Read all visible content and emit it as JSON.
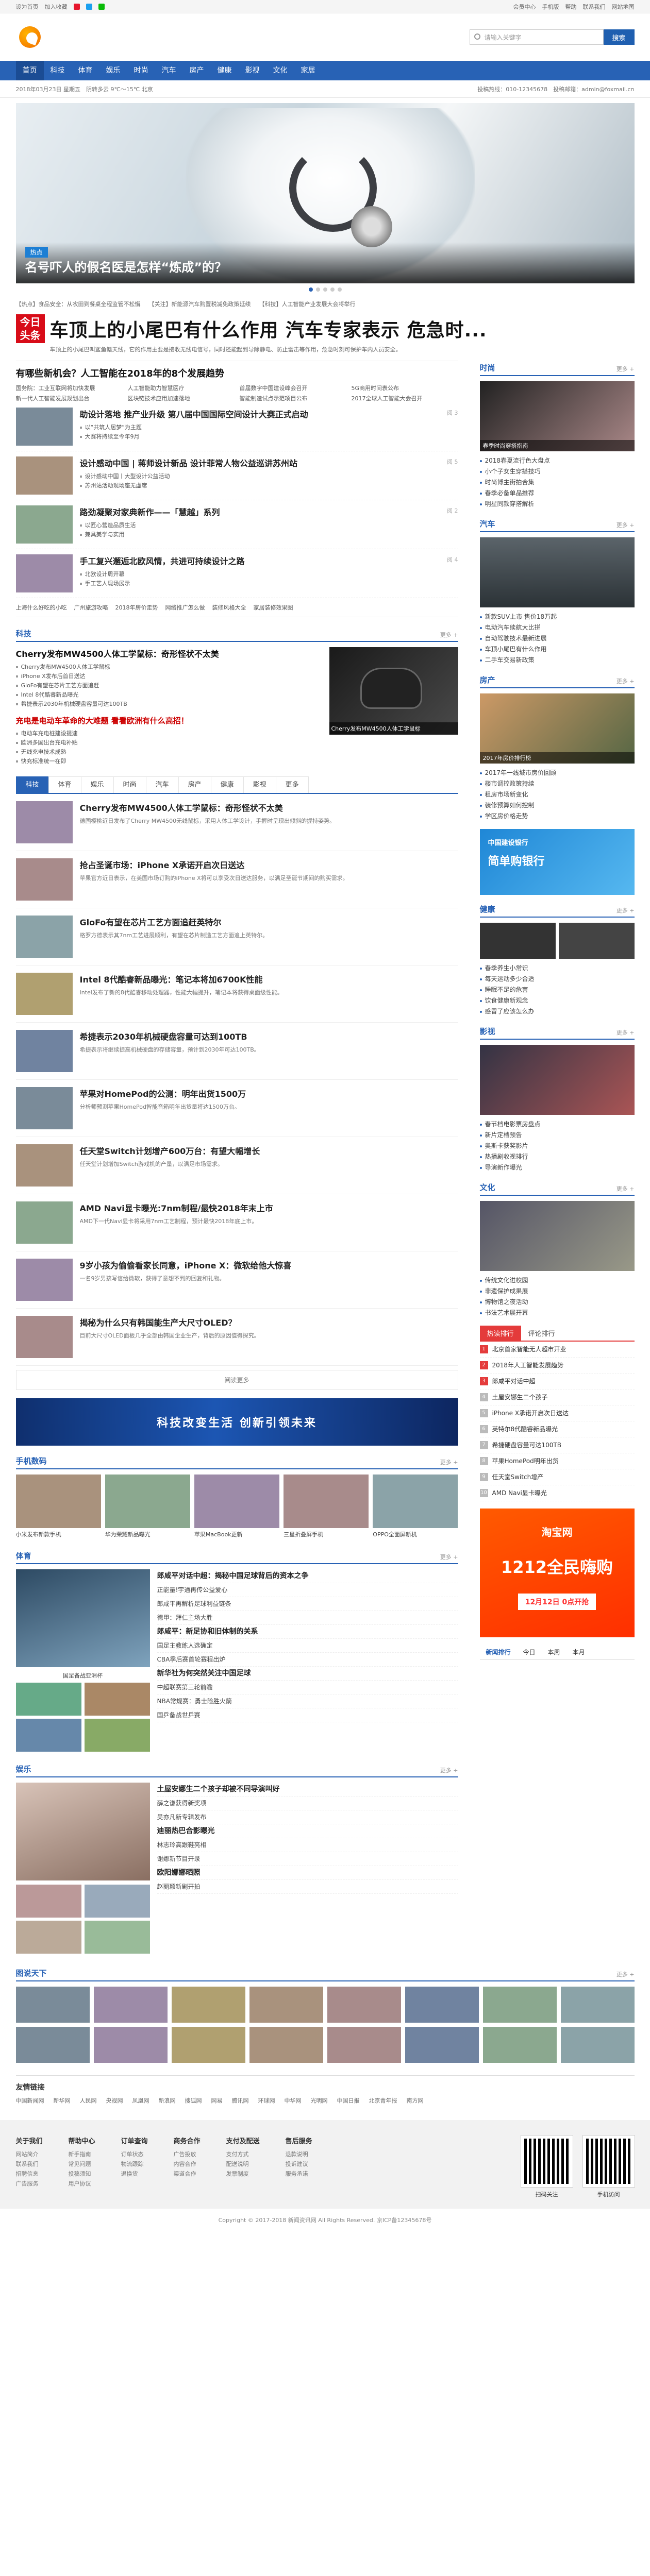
{
  "topbar": {
    "left": [
      "设为首页",
      "加入收藏",
      "新浪微博",
      "腾讯微博",
      "微信"
    ],
    "right": [
      "会员中心",
      "手机版",
      "帮助",
      "联系我们",
      "网站地图"
    ]
  },
  "search": {
    "placeholder": "请输入关键字",
    "button": "搜索"
  },
  "nav": [
    "首页",
    "科技",
    "体育",
    "娱乐",
    "时尚",
    "汽车",
    "房产",
    "健康",
    "影视",
    "文化",
    "家居"
  ],
  "subbar": {
    "date": "2018年03月23日 星期五",
    "weather": "阴转多云 9℃～15℃ 北京",
    "hotline": "投稿热线：010-12345678",
    "email": "投稿邮箱：admin@foxmail.cn"
  },
  "hero": {
    "tag": "热点",
    "title": "名号吓人的假名医是怎样“炼成”的？"
  },
  "strip": [
    "【热点】食品安全：从农田到餐桌全程监管不松懈",
    "【关注】新能源汽车购置税减免政策延续",
    "【科技】人工智能产业发展大会将举行"
  ],
  "headline": {
    "badge": "今日头条",
    "title": "车顶上的小尾巴有什么作用 汽车专家表示 危急时...",
    "sub": "车顶上的小尾巴叫鲨鱼鳍天线，它的作用主要是接收无线电信号，同时还能起到导除静电、防止雷击等作用，危急时刻可保护车内人员安全。"
  },
  "lead": {
    "title": "有哪些新机会？人工智能在2018年的8个发展趋势",
    "links": [
      "国务院：工业互联网将加快发展",
      "人工智能助力智慧医疗",
      "首届数字中国建设峰会召开",
      "5G商用时间表公布",
      "新一代人工智能发展规划出台",
      "区块链技术应用加速落地",
      "智能制造试点示范项目公布",
      "2017全球人工智能大会召开"
    ]
  },
  "list": [
    {
      "title": "助设计落地 推产业升级 第八届中国国际空间设计大赛正式启动",
      "b": [
        "以“共筑人居梦”为主题",
        "大赛将持续至今年9月"
      ],
      "m": "阅 3"
    },
    {
      "title": "设计感动中国 | 蒋师设计新品 设计菲常人物公益巡讲苏州站",
      "b": [
        "设计感动中国丨大型设计公益活动",
        "苏州站活动现场座无虚席"
      ],
      "m": "阅 5"
    },
    {
      "title": "路劲凝聚对家典新作——「慧越」系列",
      "b": [
        "以匠心营造品质生活",
        "兼具美学与实用"
      ],
      "m": "阅 2"
    },
    {
      "title": "手工复兴邂逅北欧风情，共进可持续设计之路",
      "b": [
        "北欧设计周开幕",
        "手工艺人现场展示"
      ],
      "m": "阅 4"
    }
  ],
  "linkrow": [
    "上海什么好吃的小吃",
    "广州旅游攻略",
    "2018年房价走势",
    "网络推广怎么做",
    "装修风格大全",
    "家居装修效果图"
  ],
  "tech": {
    "label": "科技",
    "more": "更多 +",
    "feat": "Cherry发布MW4500人体工学鼠标：奇形怪状不太美",
    "featsum": "Cherry发布MW4500人体工学鼠标，采用人体工学设计，握持舒适，但外观较为奇特。",
    "bullets": [
      "Cherry发布MW4500人体工学鼠标",
      "iPhone X发布后首日送达",
      "GloFo有望在芯片工艺方面追赶",
      "Intel 8代酷睿新品曝光",
      "希捷表示2030年机械硬盘容量可达100TB"
    ],
    "feat2": "充电是电动车革命的大难题 看看欧洲有什么高招！",
    "bullets2": [
      "电动车充电桩建设提速",
      "欧洲多国出台充电补贴",
      "无线充电技术成熟",
      "快充标准统一在即"
    ],
    "imgcap": "Cherry发布MW4500人体工学鼠标"
  },
  "tabs": [
    "科技",
    "体育",
    "娱乐",
    "时尚",
    "汽车",
    "房产",
    "健康",
    "影视",
    "更多"
  ],
  "feed": [
    {
      "t": "Cherry发布MW4500人体工学鼠标：奇形怪状不太美",
      "s": "德国樱桃近日发布了Cherry MW4500无线鼠标，采用人体工学设计，手握时呈现出倾斜的握持姿势。"
    },
    {
      "t": "抢占圣诞市场：iPhone X承诺开启次日送达",
      "s": "苹果官方近日表示，在美国市场订购的iPhone X将可以享受次日送达服务，以满足圣诞节期间的购买需求。"
    },
    {
      "t": "GloFo有望在芯片工艺方面追赶英特尔",
      "s": "格罗方德表示其7nm工艺进展顺利，有望在芯片制造工艺方面追上英特尔。"
    },
    {
      "t": "Intel 8代酷睿新品曝光：笔记本将加6700K性能",
      "s": "Intel发布了新的8代酷睿移动处理器，性能大幅提升，笔记本将获得桌面级性能。"
    },
    {
      "t": "希捷表示2030年机械硬盘容量可达到100TB",
      "s": "希捷表示将继续提高机械硬盘的存储容量，预计到2030年可达100TB。"
    },
    {
      "t": "苹果对HomePod的公测：明年出货1500万",
      "s": "分析师预测苹果HomePod智能音箱明年出货量将达1500万台。"
    },
    {
      "t": "任天堂Switch计划增产600万台：有望大幅增长",
      "s": "任天堂计划增加Switch游戏机的产量，以满足市场需求。"
    },
    {
      "t": "AMD Navi显卡曝光:7nm制程/最快2018年末上市",
      "s": "AMD下一代Navi显卡将采用7nm工艺制程，预计最快2018年底上市。"
    },
    {
      "t": "9岁小孩为偷偷看家长同意，iPhone X：微软给他大惊喜",
      "s": "一名9岁男孩写信给微软，获得了意想不到的回复和礼物。"
    },
    {
      "t": "揭秘为什么只有韩国能生产大尺寸OLED？",
      "s": "目前大尺寸OLED面板几乎全部由韩国企业生产，背后的原因值得探究。"
    }
  ],
  "feedmore": "阅读更多",
  "banner": "科技改变生活 创新引领未来",
  "digital": {
    "label": "手机数码",
    "more": "更多 +",
    "items": [
      "小米发布新款手机",
      "华为荣耀新品曝光",
      "苹果MacBook更新",
      "三星折叠屏手机",
      "OPPO全面屏新机"
    ]
  },
  "sports": {
    "label": "体育",
    "more": "更多 +",
    "cap": "国足备战亚洲杯",
    "items": [
      {
        "b": "郎咸平对话中超：揭秘中国足球背后的资本之争"
      },
      {
        "t": "正能量!宇通再传公益爱心"
      },
      {
        "t": "郎咸平再解析足球利益链条"
      },
      {
        "t": "德甲：拜仁主场大胜"
      },
      {
        "b": "郎咸平：新足协和旧体制的关系"
      },
      {
        "t": "国足主教练人选确定"
      },
      {
        "t": "CBA季后赛首轮赛程出炉"
      },
      {
        "b": "新华社为何突然关注中国足球"
      },
      {
        "t": "中超联赛第三轮前瞻"
      },
      {
        "t": "NBA常规赛：勇士险胜火箭"
      },
      {
        "t": "国乒备战世乒赛"
      }
    ]
  },
  "ent": {
    "label": "娱乐",
    "more": "更多 +",
    "items": [
      "土屋安娜生二个孩子却被不同导演叫好",
      "薛之谦获得新奖项",
      "吴亦凡新专辑发布",
      "迪丽热巴合影曝光",
      "林志玲高跟鞋亮相",
      "谢娜新节目开录",
      "欧阳娜娜晒照",
      "赵丽颖新剧开拍"
    ]
  },
  "r": {
    "fashion": {
      "label": "时尚",
      "more": "更多 +",
      "cap": "春季时尚穿搭指南",
      "list": [
        "2018春夏流行色大盘点",
        "小个子女生穿搭技巧",
        "时尚博主街拍合集",
        "春季必备单品推荐",
        "明星同款穿搭解析"
      ]
    },
    "auto": {
      "label": "汽车",
      "more": "更多 +",
      "list": [
        "新款SUV上市 售价18万起",
        "电动汽车续航大比拼",
        "自动驾驶技术最新进展",
        "车顶小尾巴有什么作用",
        "二手车交易新政策"
      ]
    },
    "house": {
      "label": "房产",
      "more": "更多 +",
      "cap": "2017年房价排行榜",
      "list": [
        "2017年一线城市房价回顾",
        "楼市调控政策持续",
        "租房市场新变化",
        "装修预算如何控制",
        "学区房价格走势"
      ]
    },
    "health": {
      "label": "健康",
      "more": "更多 +",
      "list": [
        "春季养生小常识",
        "每天运动多少合适",
        "睡眠不足的危害",
        "饮食健康新观念",
        "感冒了应该怎么办"
      ]
    },
    "film": {
      "label": "影视",
      "more": "更多 +",
      "list": [
        "春节档电影票房盘点",
        "新片定档预告",
        "奥斯卡获奖影片",
        "热播剧收视排行",
        "导演新作曝光"
      ]
    },
    "culture": {
      "label": "文化",
      "more": "更多 +",
      "list": [
        "传统文化进校园",
        "非遗保护成果展",
        "博物馆之夜活动",
        "书法艺术展开幕"
      ]
    },
    "ranktabs": [
      "热读排行",
      "评论排行"
    ],
    "rank": [
      "北京首家智能无人超市开业",
      "2018年人工智能发展趋势",
      "郎咸平对话中超",
      "土屋安娜生二个孩子",
      "iPhone X承诺开启次日送达",
      "英特尔8代酷睿新品曝光",
      "希捷硬盘容量可达100TB",
      "苹果HomePod明年出货",
      "任天堂Switch增产",
      "AMD Navi显卡曝光"
    ],
    "newrank": [
      "新闻排行",
      "今日",
      "本周",
      "本月"
    ],
    "taobao": {
      "a": "淘宝网",
      "b": "1212全民嗨购",
      "c": "12月12日 0点开抢"
    },
    "gov": {
      "a": "中国建设银行",
      "b": "简单购银行"
    }
  },
  "pics": {
    "label": "图说天下",
    "more": "更多 +"
  },
  "friend": {
    "label": "友情链接",
    "links": [
      "中国新闻网",
      "新华网",
      "人民网",
      "央视网",
      "凤凰网",
      "新浪网",
      "搜狐网",
      "网易",
      "腾讯网",
      "环球网",
      "中华网",
      "光明网",
      "中国日报",
      "北京青年报",
      "南方网"
    ]
  },
  "footer": {
    "cols": [
      {
        "h": "关于我们",
        "l": [
          "网站简介",
          "联系我们",
          "招聘信息",
          "广告服务"
        ]
      },
      {
        "h": "帮助中心",
        "l": [
          "新手指南",
          "常见问题",
          "投稿须知",
          "用户协议"
        ]
      },
      {
        "h": "订单查询",
        "l": [
          "订单状态",
          "物流跟踪",
          "退换货"
        ]
      },
      {
        "h": "商务合作",
        "l": [
          "广告投放",
          "内容合作",
          "渠道合作"
        ]
      },
      {
        "h": "支付及配送",
        "l": [
          "支付方式",
          "配送说明",
          "发票制度"
        ]
      },
      {
        "h": "售后服务",
        "l": [
          "退款说明",
          "投诉建议",
          "服务承诺"
        ]
      }
    ],
    "qr1": "扫码关注",
    "qr2": "手机访问",
    "copy": "Copyright © 2017-2018 新闻资讯网 All Rights Reserved. 京ICP备12345678号"
  }
}
